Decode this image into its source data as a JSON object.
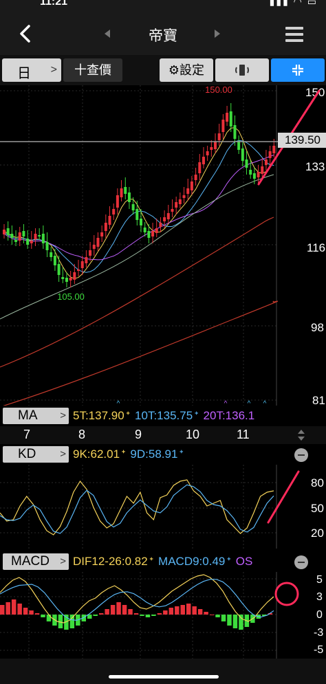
{
  "status": {
    "time": "11:21",
    "icons": "▮▮▮ ◠ ▭"
  },
  "nav": {
    "title": "帝寶"
  },
  "toolbar": {
    "period": "日",
    "price_button": "十查價",
    "settings_button": "⚙設定"
  },
  "chart_data": {
    "type": "candlestick",
    "price_axis_labels": [
      "150",
      "133",
      "116",
      "98",
      "81"
    ],
    "price_axis_range": [
      81,
      150
    ],
    "current_price_tag": "139.50",
    "high_label": "150.00",
    "low_label": "105.00",
    "date_labels": [
      "7",
      "8",
      "9",
      "10",
      "11"
    ],
    "kd_axis_labels": [
      "80",
      "50",
      "20"
    ],
    "macd_axis_labels": [
      "5",
      "3",
      "0",
      "-3",
      "-5"
    ]
  },
  "ma": {
    "name": "MA",
    "ma5": "5T:137.90",
    "ma10": "10T:135.75",
    "ma20": "20T:136.1"
  },
  "kd": {
    "name": "KD",
    "k": "9K:62.01",
    "d": "9D:58.91"
  },
  "macd": {
    "name": "MACD",
    "dif": "DIF12-26:0.82",
    "macd9": "MACD9:0.49",
    "osc": "OS"
  },
  "colors": {
    "up": "#e8313a",
    "down": "#3ddc3d",
    "accent": "#1e90ff",
    "annotation": "#ff2a5a"
  }
}
